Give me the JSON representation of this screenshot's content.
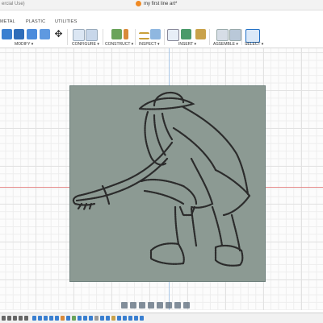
{
  "title_bar": {
    "left_text": "ercial Use)",
    "document_title": "my first line art*"
  },
  "tabs": [
    "METAL",
    "PLASTIC",
    "UTILITIES"
  ],
  "toolbar_groups": [
    {
      "label": "MODIFY ▾"
    },
    {
      "label": "CONFIGURE ▾"
    },
    {
      "label": "CONSTRUCT ▾"
    },
    {
      "label": "INSPECT ▾"
    },
    {
      "label": "INSERT ▾"
    },
    {
      "label": "ASSEMBLE ▾"
    },
    {
      "label": "SELECT ▾"
    }
  ],
  "canvas": {
    "plate_color": "#8c9a93",
    "artwork": "line-art figure of a crouching person in a brimmed hat reaching forward"
  },
  "navigation_icons": [
    "orbit-icon",
    "pan-icon",
    "zoom-icon",
    "fit-icon",
    "look-at-icon",
    "display-settings-icon",
    "grid-icon",
    "viewports-icon"
  ],
  "colors": {
    "axis_x": "#e58a8a",
    "axis_y": "#a9c7e8",
    "accent": "#1f6fc5"
  }
}
